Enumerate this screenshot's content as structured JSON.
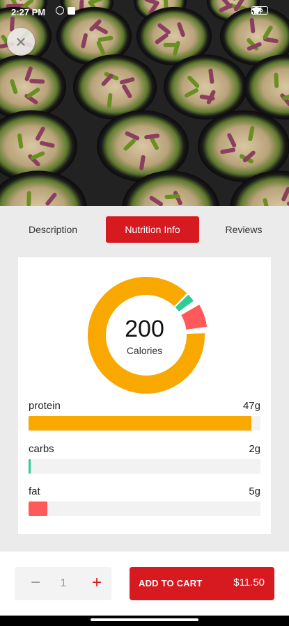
{
  "status": {
    "time": "2:27 PM",
    "battery": "85"
  },
  "tabs": {
    "description": "Description",
    "nutrition": "Nutrition Info",
    "reviews": "Reviews"
  },
  "nutrition": {
    "calories_value": "200",
    "calories_label": "Calories",
    "nutrients": [
      {
        "name": "protein",
        "amount": "47g",
        "fraction": 0.96,
        "color": "#f9a800"
      },
      {
        "name": "carbs",
        "amount": "2g",
        "fraction": 0.01,
        "color": "#2ecc9a"
      },
      {
        "name": "fat",
        "amount": "5g",
        "fraction": 0.08,
        "color": "#ff5a5a"
      }
    ]
  },
  "colors": {
    "accent": "#d71920",
    "protein": "#f9a800",
    "carbs": "#2ecc9a",
    "fat": "#ff5a5a"
  },
  "cart": {
    "quantity": "1",
    "minus": "−",
    "plus": "+",
    "add_label": "ADD TO CART",
    "price": "$11.50"
  },
  "close": "×"
}
